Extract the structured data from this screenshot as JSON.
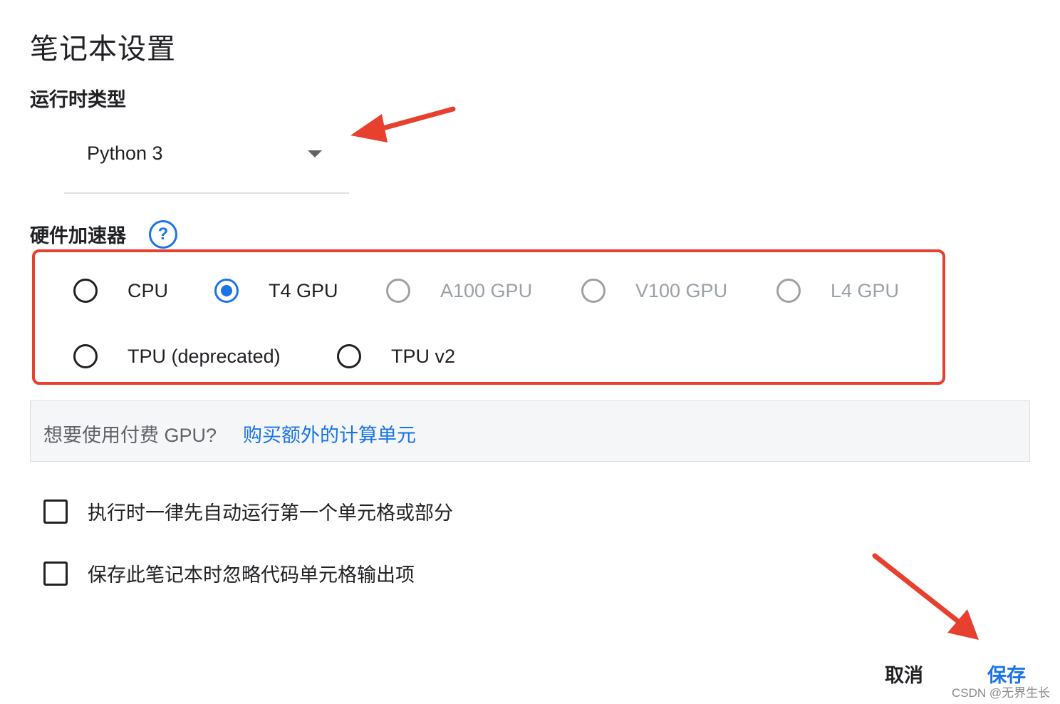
{
  "dialog": {
    "title": "笔记本设置"
  },
  "runtime": {
    "label": "运行时类型",
    "value": "Python 3"
  },
  "hardware": {
    "label": "硬件加速器",
    "help_icon": "help-circle-icon",
    "options": [
      {
        "label": "CPU",
        "checked": false,
        "disabled": false
      },
      {
        "label": "T4 GPU",
        "checked": true,
        "disabled": false
      },
      {
        "label": "A100 GPU",
        "checked": false,
        "disabled": true
      },
      {
        "label": "V100 GPU",
        "checked": false,
        "disabled": true
      },
      {
        "label": "L4 GPU",
        "checked": false,
        "disabled": true
      },
      {
        "label": "TPU (deprecated)",
        "checked": false,
        "disabled": false
      },
      {
        "label": "TPU v2",
        "checked": false,
        "disabled": false
      }
    ]
  },
  "promo": {
    "text": "想要使用付费 GPU?",
    "link": "购买额外的计算单元"
  },
  "checkboxes": [
    {
      "label": "执行时一律先自动运行第一个单元格或部分",
      "checked": false
    },
    {
      "label": "保存此笔记本时忽略代码单元格输出项",
      "checked": false
    }
  ],
  "actions": {
    "cancel": "取消",
    "save": "保存"
  },
  "watermark": "CSDN @无界生长",
  "colors": {
    "accent": "#1a73e8",
    "annotation": "#e8402f"
  }
}
